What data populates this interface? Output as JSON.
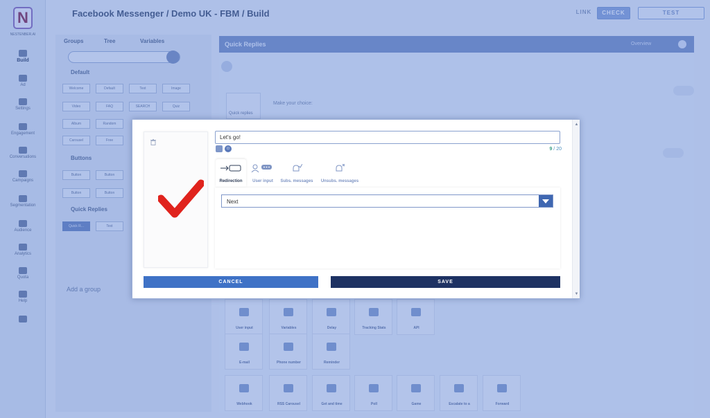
{
  "app": {
    "logo_letter": "N",
    "logo_text": "NESTENBER.AI",
    "breadcrumb": "Facebook Messenger / Demo UK - FBM / Build",
    "actions": {
      "link_label": "LINK",
      "check_label": "CHECK",
      "test_label": "TEST"
    }
  },
  "nav": [
    {
      "label": "Build",
      "icon": "wrench-icon"
    },
    {
      "label": "Ad",
      "icon": "megaphone-icon"
    },
    {
      "label": "Settings",
      "icon": "gear-icon"
    },
    {
      "label": "Engagement",
      "icon": "target-icon"
    },
    {
      "label": "Conversations",
      "icon": "inbox-icon"
    },
    {
      "label": "Campaigns",
      "icon": "broadcast-icon"
    },
    {
      "label": "Segmentation",
      "icon": "search-icon"
    },
    {
      "label": "Audience",
      "icon": "users-icon"
    },
    {
      "label": "Analytics",
      "icon": "chart-icon"
    },
    {
      "label": "Quota",
      "icon": "info-icon"
    },
    {
      "label": "Help",
      "icon": "question-icon"
    },
    {
      "label": "",
      "icon": "flag-icon"
    }
  ],
  "left_panel": {
    "tabs": [
      "Groups",
      "Tree",
      "Variables"
    ],
    "sections": {
      "default": "Default",
      "buttons": "Buttons",
      "quick_replies": "Quick Replies"
    },
    "default_chips": [
      "Welcome",
      "Default",
      "Text",
      "Image",
      "Video",
      "FAQ",
      "SEARCH",
      "Quiz",
      "Album",
      "Random",
      "Carousel",
      "Free"
    ],
    "button_chips": [
      "Button",
      "Button",
      "Button",
      "Button"
    ],
    "quick_reply_chips": [
      "Quick R...",
      "Text"
    ],
    "add_group": "Add a group"
  },
  "main_panel": {
    "title": "Quick Replies",
    "header_link": "Overview",
    "card_label": "Quick replies",
    "prompt": "Make your choice:",
    "tile_rows": [
      [
        "User input",
        "Variables",
        "Delay",
        "Tracking Stats",
        "API"
      ],
      [
        "E-mail",
        "Phone number",
        "Reminder"
      ],
      [
        "Webhook",
        "RSS Carousel",
        "Get and time",
        "Poll",
        "Game",
        "Escalate to a",
        "Forward"
      ]
    ]
  },
  "modal": {
    "text_value": "Let's go!",
    "char_count": "9",
    "char_sep": " / ",
    "char_max": "20",
    "tabs": [
      {
        "label": "Redirection",
        "icon": "redirect-arrow-icon"
      },
      {
        "label": "User input",
        "icon": "user-chat-icon"
      },
      {
        "label": "Subs. messages",
        "icon": "bell-check-icon"
      },
      {
        "label": "Unsubs. messages",
        "icon": "bell-off-icon"
      }
    ],
    "active_tab": "Redirection",
    "select_value": "Next",
    "cancel_label": "CANCEL",
    "save_label": "SAVE",
    "check_color": "#e0231d",
    "accent_color": "#3f72c6",
    "save_color": "#1e3263"
  }
}
